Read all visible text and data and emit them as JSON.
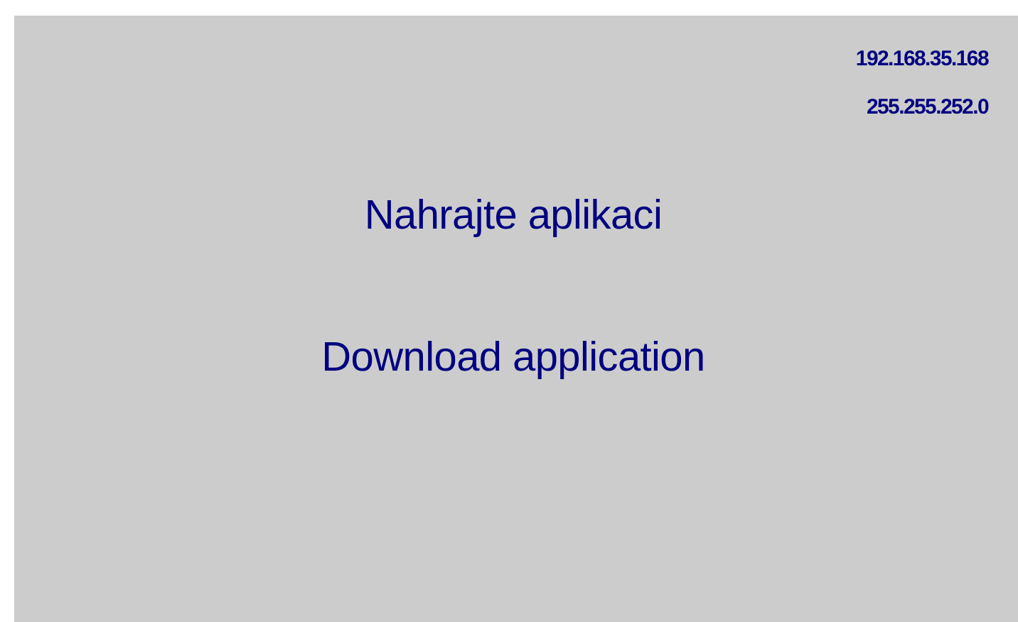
{
  "network": {
    "ip_address": "192.168.35.168",
    "subnet_mask": "255.255.252.0"
  },
  "messages": [
    "Nahrajte aplikaci",
    "Download application"
  ]
}
